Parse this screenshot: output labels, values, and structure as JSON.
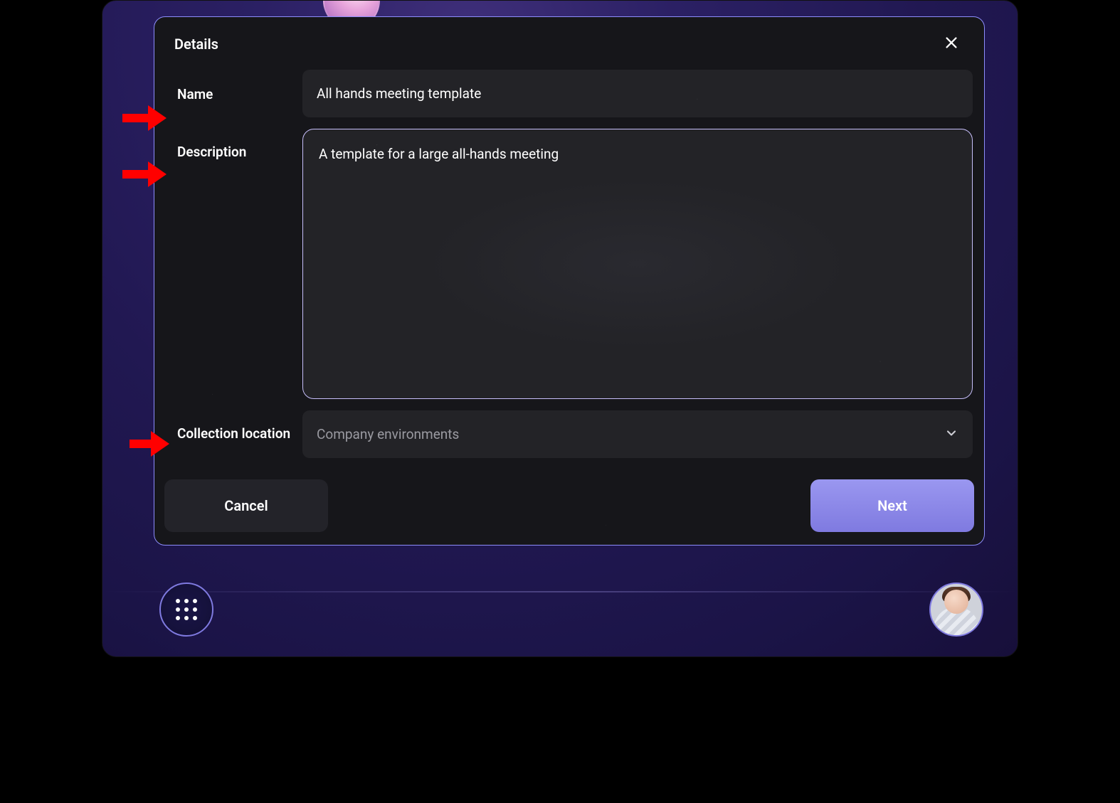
{
  "modal": {
    "title": "Details",
    "fields": {
      "name": {
        "label": "Name",
        "value": "All hands meeting template"
      },
      "description": {
        "label": "Description",
        "value": "A template for a large all-hands meeting"
      },
      "collection": {
        "label": "Collection location",
        "placeholder": "Company environments"
      }
    },
    "buttons": {
      "cancel": "Cancel",
      "next": "Next"
    }
  },
  "annotationArrows": {
    "color": "#ff0000"
  }
}
